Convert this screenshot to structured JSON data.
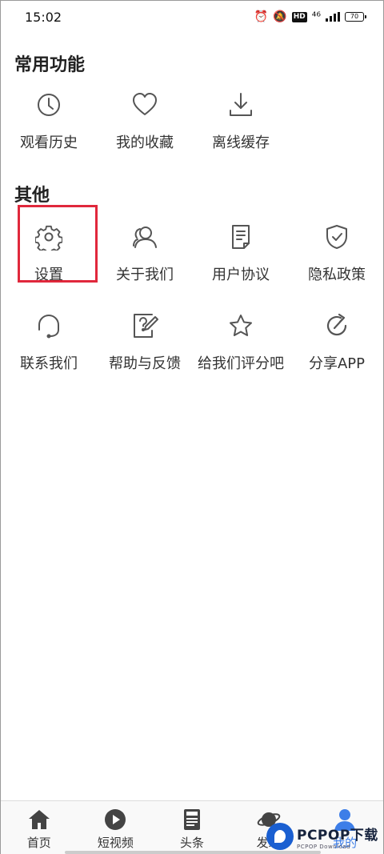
{
  "status_bar": {
    "time": "15:02",
    "network": "⁴⁶",
    "battery": "70",
    "hd": "HD"
  },
  "sections": {
    "common": {
      "title": "常用功能",
      "items": [
        {
          "label": "观看历史",
          "icon": "clock-icon"
        },
        {
          "label": "我的收藏",
          "icon": "heart-icon"
        },
        {
          "label": "离线缓存",
          "icon": "download-icon"
        }
      ]
    },
    "other": {
      "title": "其他",
      "items": [
        {
          "label": "设置",
          "icon": "gear-icon"
        },
        {
          "label": "关于我们",
          "icon": "users-icon"
        },
        {
          "label": "用户协议",
          "icon": "document-icon"
        },
        {
          "label": "隐私政策",
          "icon": "shield-icon"
        },
        {
          "label": "联系我们",
          "icon": "headset-icon"
        },
        {
          "label": "帮助与反馈",
          "icon": "help-edit-icon"
        },
        {
          "label": "给我们评分吧",
          "icon": "star-icon"
        },
        {
          "label": "分享APP",
          "icon": "share-icon"
        }
      ]
    }
  },
  "tabbar": {
    "items": [
      {
        "label": "首页",
        "icon": "home-icon"
      },
      {
        "label": "短视频",
        "icon": "play-icon"
      },
      {
        "label": "头条",
        "icon": "news-icon"
      },
      {
        "label": "发现",
        "icon": "planet-icon"
      },
      {
        "label": "我的",
        "icon": "user-icon"
      }
    ],
    "active_index": 4
  },
  "watermark": {
    "main": "PCPOP下载",
    "sub": "PCPOP Download"
  },
  "colors": {
    "highlight": "#e0283c",
    "active_tab": "#3d7ee8",
    "icon": "#555555"
  }
}
